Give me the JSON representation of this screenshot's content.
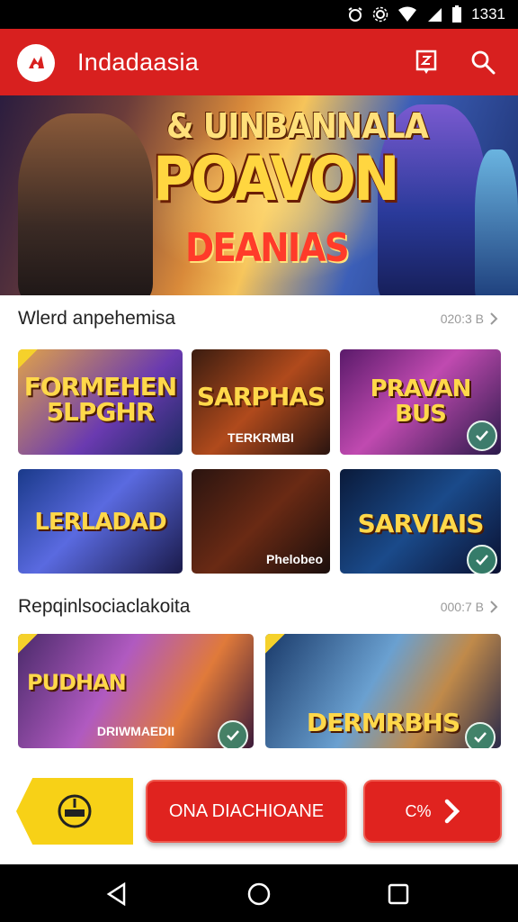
{
  "status_bar": {
    "time": "1331"
  },
  "app_bar": {
    "title": "Indadaasia"
  },
  "hero": {
    "line1": "& UINBANNALA",
    "line2": "POAVON",
    "line3": "DEANIAS"
  },
  "sections": [
    {
      "title": "Wlerd anpehemisa",
      "more": "020:3 B",
      "cards": [
        {
          "label": "FORMEHEN\n5LPGHR",
          "sub": ""
        },
        {
          "label": "SARPHAS",
          "sub": "TERKRMBI"
        },
        {
          "label": "PRAVAN\nBUS",
          "sub": ""
        },
        {
          "label": "LERLADAD",
          "sub": ""
        },
        {
          "label": "",
          "sub": "Phelobeo"
        },
        {
          "label": "SARVIAIS",
          "sub": ""
        }
      ]
    },
    {
      "title": "Repqinlsociaclakoita",
      "more": "000:7 B",
      "cards": [
        {
          "label": "PUDHAN",
          "sub": "DRIWMAEDII"
        },
        {
          "label": "DERMRBHS",
          "sub": ""
        }
      ]
    }
  ],
  "bottom": {
    "main_button": "ONA DIACHIOANE",
    "side_button": "C%"
  },
  "colors": {
    "brand": "#d8201f",
    "accent": "#f7d117"
  },
  "icons": [
    "logo-icon",
    "share-icon",
    "search-icon",
    "chevron-right-icon",
    "check-icon",
    "back-icon",
    "home-icon",
    "recents-icon"
  ]
}
